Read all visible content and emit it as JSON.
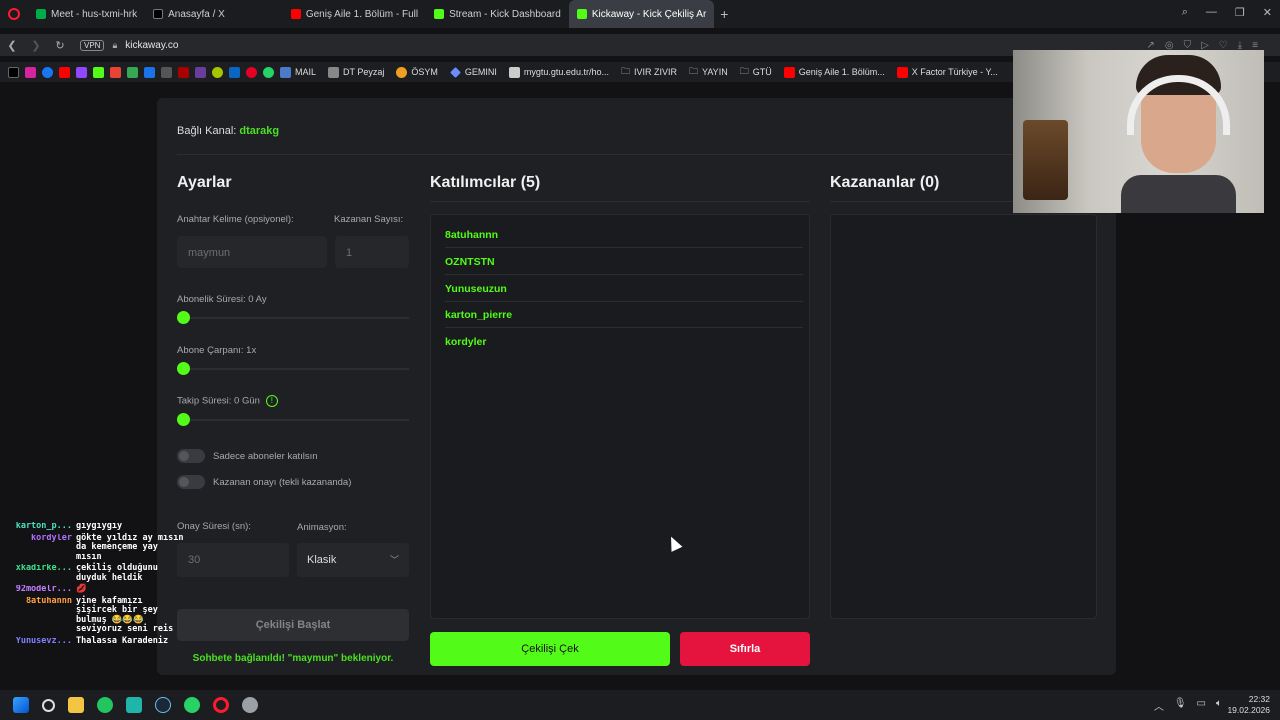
{
  "browser": {
    "tabs": [
      {
        "label": "Meet - hus-txmi-hrk",
        "color": "#00ac47"
      },
      {
        "label": "Anasayfa / X",
        "color": "#000000"
      },
      {
        "label": "Geniş Aile 1. Bölüm - Full",
        "color": "#ff0000"
      },
      {
        "label": "Stream - Kick Dashboard",
        "color": "#53fc18"
      },
      {
        "label": "Kickaway - Kick Çekiliş Ar",
        "color": "#53fc18",
        "active": true
      }
    ],
    "vpn": "VPN",
    "url": "kickaway.co",
    "bookmarks": [
      {
        "label": "MAIL",
        "color": "#4a7ac8"
      },
      {
        "label": "DT Peyzaj",
        "color": "#888888"
      },
      {
        "label": "ÖSYM",
        "color": "#f0a020"
      },
      {
        "label": "GEMINI",
        "color": "#6a8cff"
      },
      {
        "label": "mygtu.gtu.edu.tr/ho...",
        "color": "#cccccc"
      },
      {
        "label": "IVIR ZIVIR",
        "color": "#999999"
      },
      {
        "label": "YAYIN",
        "color": "#999999"
      },
      {
        "label": "GTÜ",
        "color": "#999999"
      },
      {
        "label": "Geniş Aile 1. Bölüm...",
        "color": "#ff0000"
      },
      {
        "label": "X Factor Türkiye - Y...",
        "color": "#ff0000"
      }
    ]
  },
  "app": {
    "linked_label": "Bağlı Kanal:",
    "linked_channel": "dtarakg",
    "settings": {
      "title": "Ayarlar",
      "keyword_label": "Anahtar Kelime (opsiyonel):",
      "keyword_placeholder": "maymun",
      "winners_label": "Kazanan Sayısı:",
      "winners_value": "1",
      "sub_duration_label": "Abonelik Süresi: 0 Ay",
      "sub_duration_value": 0,
      "sub_multiplier_label": "Abone Çarpanı: 1x",
      "sub_multiplier_value": 1,
      "follow_duration_label": "Takip Süresi: 0 Gün",
      "follow_duration_value": 0,
      "info_icon": "!",
      "subs_only_label": "Sadece aboneler katılsın",
      "winner_confirm_label": "Kazanan onayı (tekli kazananda)",
      "confirm_time_label": "Onay Süresi (sn):",
      "confirm_time_value": "30",
      "animation_label": "Animasyon:",
      "animation_value": "Klasik",
      "start_button": "Çekilişi Başlat",
      "status": "Sohbete bağlanıldı! \"maymun\" bekleniyor."
    },
    "participants": {
      "title": "Katılımcılar (5)",
      "list": [
        "8atuhannn",
        "OZNTSTN",
        "Yunuseuzun",
        "karton_pierre",
        "kordyler"
      ]
    },
    "winners": {
      "title": "Kazananlar (0)"
    },
    "draw_button": "Çekilişi Çek",
    "reset_button": "Sıfırla"
  },
  "chat": [
    {
      "user": "karton_p...",
      "color": "#4be0c0",
      "msg": "gıygıygıy"
    },
    {
      "user": "kordyler",
      "color": "#b070ff",
      "msg": "gökte yıldız ay mısın da kemençeme yay mısın"
    },
    {
      "user": "xkadirke...",
      "color": "#3ce08a",
      "msg": "çekiliş olduğunu duyduk heldik"
    },
    {
      "user": "92modelr...",
      "color": "#c080ff",
      "msg": "💋"
    },
    {
      "user": "8atuhannn",
      "color": "#ffa040",
      "msg": "yine kafamızı şişircek bir şey bulmuş 😂😂😂 seviyoruz seni reis"
    },
    {
      "user": "Yunusevz...",
      "color": "#8080ff",
      "msg": "Thalassa Karadeniz"
    }
  ],
  "taskbar": {
    "time": "22:32",
    "date": "19.02.2026"
  }
}
